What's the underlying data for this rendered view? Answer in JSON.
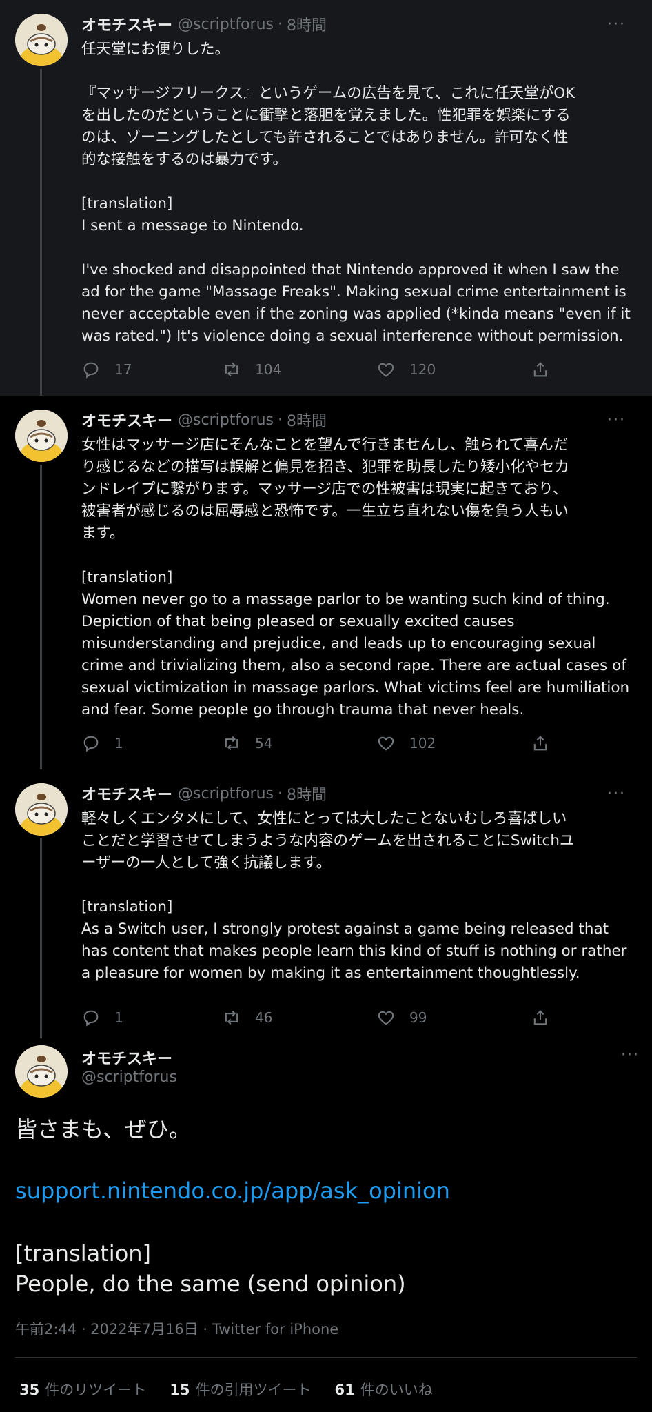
{
  "tweets": [
    {
      "name": "オモチスキー",
      "handle": "@scriptforus",
      "time": "8時間",
      "para1": "任天堂にお便りした。",
      "para2": "『マッサージフリークス』というゲームの広告を見て、これに任天堂がOK\nを出したのだということに衝撃と落胆を覚えました。性犯罪を娯楽にする\nのは、ゾーニングしたとしても許されることではありません。許可なく性\n的な接触をするのは暴力です。",
      "para3": "[translation]\nI sent a message to Nintendo.",
      "para4": "I've shocked and disappointed that Nintendo approved it when I saw the\nad for the game \"Massage Freaks\". Making sexual crime entertainment is\nnever acceptable even if the zoning was applied (*kinda means \"even if it\nwas rated.\") It's violence doing a sexual interference without permission.",
      "replies": "17",
      "retweets": "104",
      "likes": "120"
    },
    {
      "name": "オモチスキー",
      "handle": "@scriptforus",
      "time": "8時間",
      "para1": "女性はマッサージ店にそんなことを望んで行きませんし、触られて喜んだ\nり感じるなどの描写は誤解と偏見を招き、犯罪を助長したり矮小化やセカ\nンドレイプに繋がります。マッサージ店での性被害は現実に起きており、\n被害者が感じるのは屈辱感と恐怖です。一生立ち直れない傷を負う人もい\nます。",
      "para2": "[translation]\nWomen never go to a massage parlor to be wanting such kind of thing.\nDepiction of that being pleased or sexually excited causes\nmisunderstanding and prejudice, and leads up to encouraging sexual\ncrime and trivializing them, also a second rape. There are actual cases of\nsexual victimization in massage parlors. What victims feel are humiliation\nand fear. Some people go through trauma that never heals.",
      "replies": "1",
      "retweets": "54",
      "likes": "102"
    },
    {
      "name": "オモチスキー",
      "handle": "@scriptforus",
      "time": "8時間",
      "para1": "軽々しくエンタメにして、女性にとっては大したことないむしろ喜ばしい\nことだと学習させてしまうような内容のゲームを出されることにSwitchユ\nーザーの一人として強く抗議します。",
      "para2": "[translation]\nAs a Switch user, I strongly protest against a game being released that\nhas content that makes people learn this kind of stuff is nothing or rather\na pleasure for women by making it as entertainment thoughtlessly.",
      "replies": "1",
      "retweets": "46",
      "likes": "99"
    }
  ],
  "main": {
    "name": "オモチスキー",
    "handle": "@scriptforus",
    "line1": "皆さまも、ぜひ。",
    "link": "support.nintendo.co.jp/app/ask_opinion",
    "line2": "[translation]\nPeople, do the same (send opinion)",
    "meta": "午前2:44 · 2022年7月16日 · Twitter for iPhone",
    "retweets_count": "35",
    "retweets_label": "件のリツイート",
    "quotes_count": "15",
    "quotes_label": "件の引用ツイート",
    "likes_count": "61",
    "likes_label": "件のいいね"
  },
  "ui": {
    "dot": "·",
    "more": "···"
  },
  "icons": {
    "reply": "reply-icon",
    "retweet": "retweet-icon",
    "like": "heart-icon",
    "share": "share-icon",
    "more": "more-icon"
  },
  "colors": {
    "background": "#000000",
    "highlight": "#16181c",
    "link": "#1d9bf0",
    "muted": "#71767b",
    "text": "#e7e9ea"
  }
}
